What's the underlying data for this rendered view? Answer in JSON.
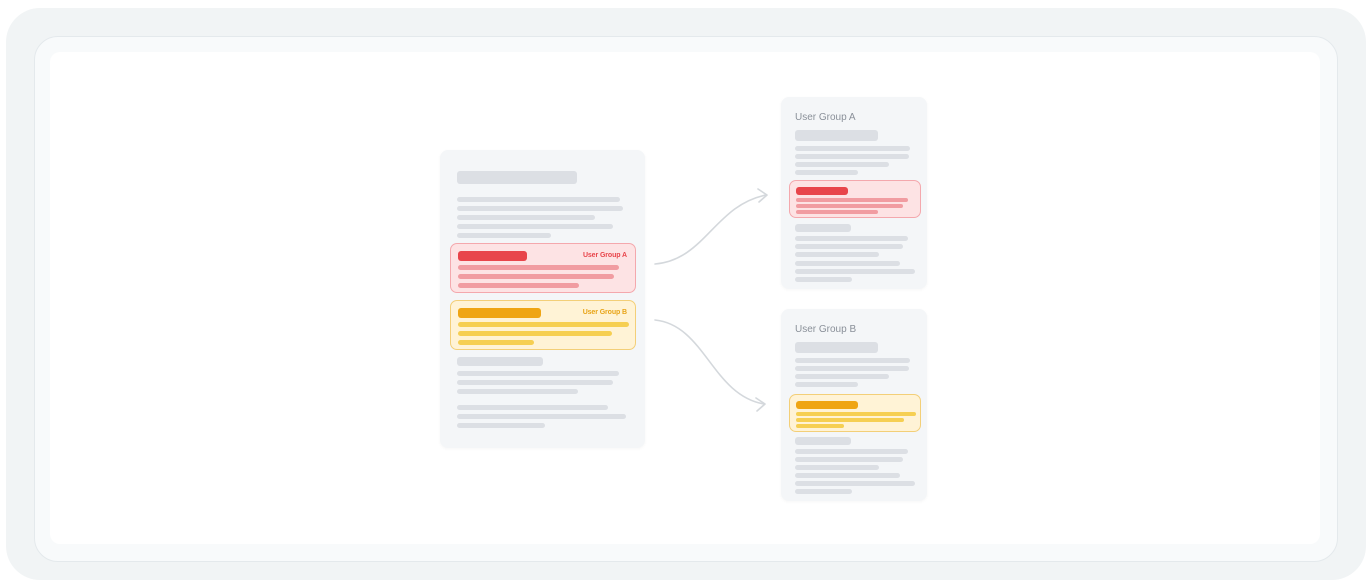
{
  "source_document": {
    "block_a_tag": "User Group A",
    "block_b_tag": "User Group B"
  },
  "outputs": [
    {
      "title": "User Group A",
      "highlight": "red"
    },
    {
      "title": "User Group B",
      "highlight": "yellow"
    }
  ],
  "colors": {
    "group_a_strong": "#e8454b",
    "group_a_soft": "#f19ca1",
    "group_b_strong": "#efa514",
    "group_b_soft": "#f6cf52",
    "placeholder": "#dcdfe4"
  },
  "connectors": [
    {
      "from": "source-block-a",
      "to": "output-doc-a",
      "icon": "arrow-icon"
    },
    {
      "from": "source-block-b",
      "to": "output-doc-b",
      "icon": "arrow-icon"
    }
  ]
}
